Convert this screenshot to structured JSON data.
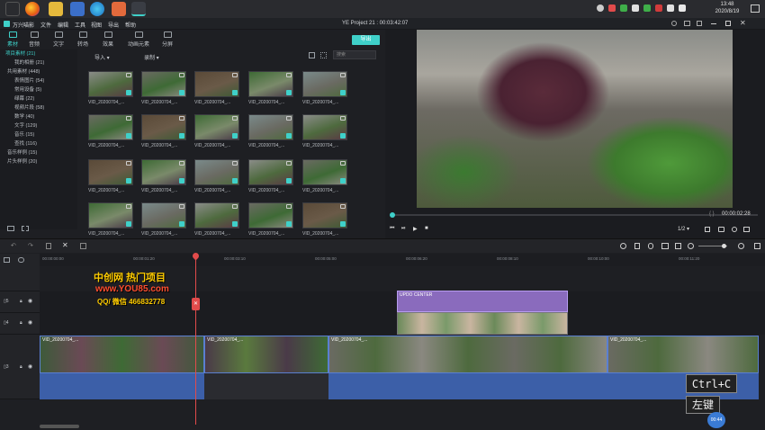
{
  "taskbar": {
    "time": "13:48",
    "date": "2020/8/19"
  },
  "menubar": {
    "app_name": "万兴喵影",
    "items": [
      "文件",
      "编辑",
      "工具",
      "视图",
      "导出",
      "帮助"
    ],
    "project_title": "YE Project 21 : 00:03:42:07"
  },
  "toolbar_tabs": [
    {
      "label": "素材",
      "icon": "folder-icon"
    },
    {
      "label": "音频",
      "icon": "music-icon"
    },
    {
      "label": "文字",
      "icon": "text-icon"
    },
    {
      "label": "转场",
      "icon": "transition-icon"
    },
    {
      "label": "效果",
      "icon": "effect-icon"
    },
    {
      "label": "动画元素",
      "icon": "elements-icon"
    },
    {
      "label": "分屏",
      "icon": "split-screen-icon"
    }
  ],
  "export_label": "导出",
  "library": {
    "nodes": [
      "项目素材 (21)",
      "我的相册 (21)",
      "共用素材 (448)",
      "表情图片 (54)",
      "常用设备 (5)",
      "绿幕 (22)",
      "视频片段 (58)",
      "数学 (40)",
      "文字 (129)",
      "音乐 (15)",
      "查找 (116)",
      "音乐样例 (15)",
      "片头样例 (20)"
    ]
  },
  "bin": {
    "import_label": "导入",
    "record_label": "录制",
    "search_placeholder": "搜索",
    "clip_label": "VID_20200704_..."
  },
  "preview": {
    "timecode": "00:00:02:28",
    "ratio": "1/2"
  },
  "timeline": {
    "ruler": [
      "00:00:00:00",
      "00:00:01:20",
      "00:00:03:10",
      "00:00:05:00",
      "00:00:06:20",
      "00:00:08:10",
      "00:00:10:00",
      "00:00:11:20"
    ],
    "tracks": [
      "5",
      "4",
      "3"
    ],
    "title_clip": "UPDO CENTER",
    "video_clips": [
      "VID_20200704_...",
      "VID_20200704_...",
      "VID_20200704_...",
      "VID_20200704_..."
    ]
  },
  "watermark": {
    "line1": "中创网 热门项目",
    "line2": "www.YOU85.com",
    "line3": "QQ/ 微信 466832778"
  },
  "overlay": {
    "shortcut": "Ctrl+C",
    "mouse": "左键",
    "badge": "00:44"
  }
}
